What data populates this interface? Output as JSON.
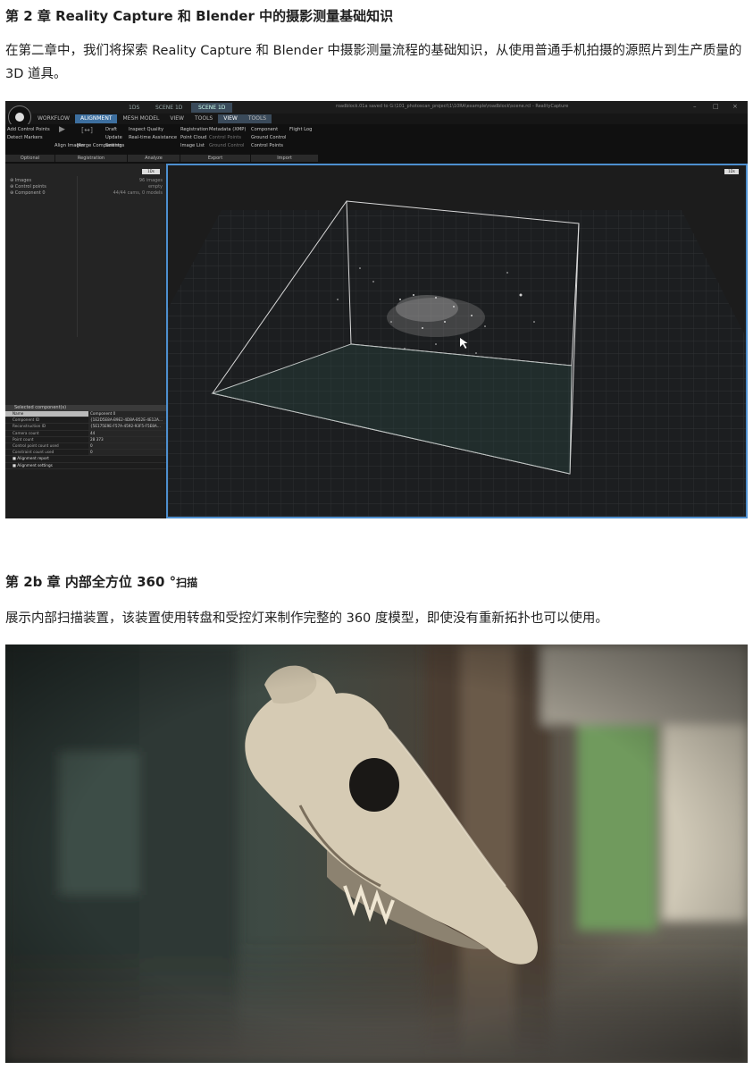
{
  "section1": {
    "heading": "第 2 章 Reality Capture 和 Blender 中的摄影测量基础知识",
    "paragraph": "在第二章中，我们将探索 Reality Capture 和 Blender 中摄影测量流程的基础知识，从使用普通手机拍摄的源照片到生产质量的 3D 道具。"
  },
  "section2": {
    "heading_main": "第 2b 章 内部全方位 360 °",
    "heading_tail": "扫描",
    "paragraph": "展示内部扫描装置，该装置使用转盘和受控灯来制作完整的 360 度模型，即使没有重新拓扑也可以使用。"
  },
  "app": {
    "title_tabs": [
      "1DS",
      "SCENE 1D",
      "SCENE 1D"
    ],
    "title_path": "roadblock.01a saved to G:\\101_photoscan_project\\1\\10RA\\example\\roadblock\\scene.rcl - RealityCapture",
    "window_buttons": [
      "–",
      "□",
      "×"
    ],
    "menu": [
      "WORKFLOW",
      "ALIGNMENT",
      "MESH MODEL",
      "VIEW",
      "TOOLS",
      "VIEW",
      "TOOLS"
    ],
    "ribbon": {
      "col1": [
        "Add Control Points",
        "Detect Markers"
      ],
      "align": "Align Images",
      "merge": "Merge Components",
      "col3": [
        "Draft",
        "Update",
        "Settings"
      ],
      "col4": [
        "Inspect Quality",
        "Real-time Assistance"
      ],
      "col5": [
        "Registration",
        "Point Cloud",
        "Image List"
      ],
      "col6": [
        "Metadata (XMP)",
        "Control Points",
        "Ground Control"
      ],
      "col7": [
        "Component",
        "Ground Control",
        "Control Points"
      ],
      "col8": [
        "Flight Log"
      ]
    },
    "groups": [
      "Optional",
      "Registration",
      "Analyze",
      "Export",
      "Import"
    ],
    "tree": [
      {
        "label": "Images",
        "value": "96 images"
      },
      {
        "label": "Control points",
        "value": "empty"
      },
      {
        "label": "Component 0",
        "value": "44/44 cams, 0 models"
      }
    ],
    "left_button": "1Ds",
    "props_header": "Selected component(s)",
    "props": [
      {
        "k": "Name",
        "v": "Component 0"
      },
      {
        "k": "Component ID",
        "v": "{1E2D5E8A-B9E2-4D8A-B52E-4E12A…"
      },
      {
        "k": "Reconstruction ID",
        "v": "{5E175E9E-F57A-4592-93F5-F5E8A…"
      },
      {
        "k": "Camera count",
        "v": "44"
      },
      {
        "k": "Point count",
        "v": "28 373"
      },
      {
        "k": "Control point count used",
        "v": "0"
      },
      {
        "k": "Constraint count used",
        "v": "0"
      }
    ],
    "props_sections": [
      "Alignment report",
      "Alignment settings"
    ],
    "view_button": "1Ds"
  },
  "colors": {
    "accent": "#4d8fcf",
    "app_bg": "#161616"
  }
}
